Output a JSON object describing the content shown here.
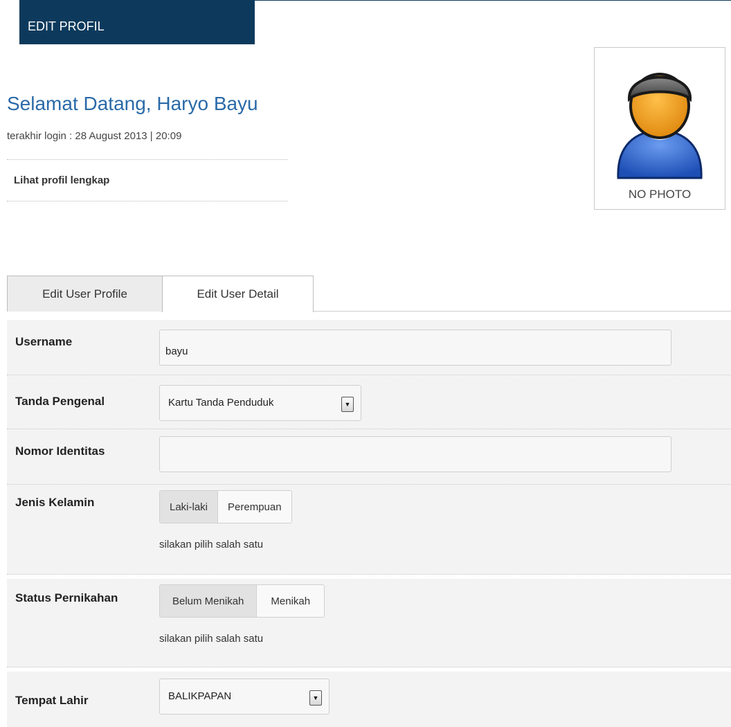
{
  "header": {
    "title": "EDIT PROFIL"
  },
  "user": {
    "welcome": "Selamat Datang, Haryo Bayu",
    "last_login": "terakhir login : 28 August 2013 | 20:09",
    "profile_link": "Lihat profil lengkap",
    "photo_label": "NO PHOTO"
  },
  "tabs": [
    {
      "label": "Edit User Profile"
    },
    {
      "label": "Edit User Detail"
    }
  ],
  "form": {
    "username": {
      "label": "Username",
      "value": "bayu"
    },
    "tanda_pengenal": {
      "label": "Tanda Pengenal",
      "value": "Kartu Tanda Penduduk"
    },
    "nomor_identitas": {
      "label": "Nomor Identitas",
      "value": ""
    },
    "jenis_kelamin": {
      "label": "Jenis Kelamin",
      "options": [
        "Laki-laki",
        "Perempuan"
      ],
      "hint": "silakan pilih salah satu"
    },
    "status_pernikahan": {
      "label": "Status Pernikahan",
      "options": [
        "Belum Menikah",
        "Menikah"
      ],
      "hint": "silakan pilih salah satu"
    },
    "tempat_lahir": {
      "label": "Tempat Lahir",
      "value": "BALIKPAPAN"
    }
  },
  "colors": {
    "header_bg": "#0d3a5c",
    "welcome_text": "#2a6aa8",
    "row_bg": "#f3f3f3"
  },
  "icons": {
    "dropdown": "dropdown-arrow-icon",
    "avatar": "user-avatar-icon"
  }
}
